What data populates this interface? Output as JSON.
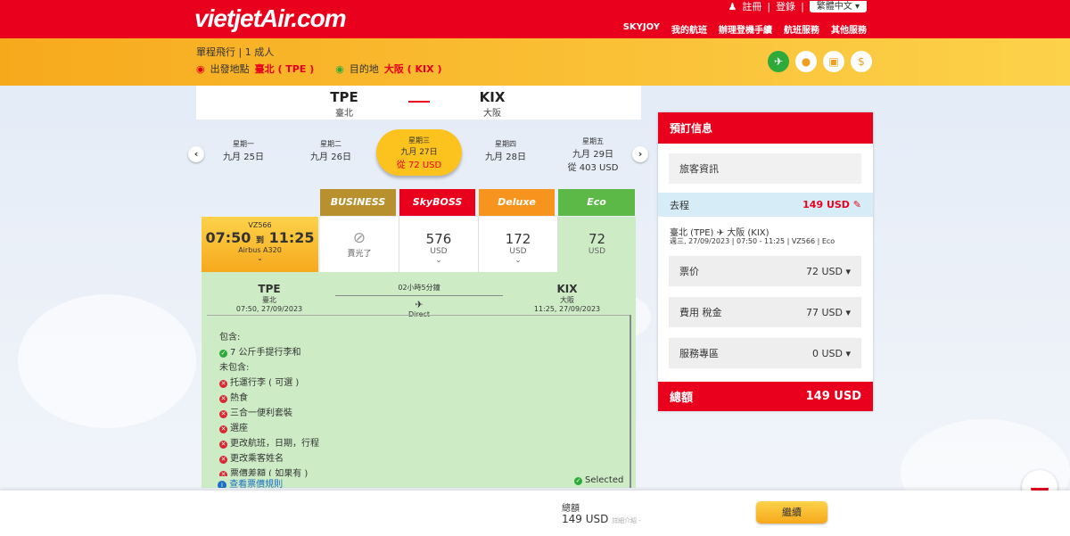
{
  "header": {
    "logo": "vietjetAir.com",
    "register": "註冊",
    "login": "登錄",
    "language": "繁體中文",
    "nav": [
      "SKYJOY",
      "我的航班",
      "辦理登機手續",
      "航班服務",
      "其他服務"
    ]
  },
  "trip": {
    "summary": "單程飛行 | 1 成人",
    "origin_label": "出發地點",
    "origin": "臺北 ( TPE )",
    "dest_label": "目的地",
    "dest": "大阪 ( KIX )"
  },
  "route": {
    "from_code": "TPE",
    "from_city": "臺北",
    "to_code": "KIX",
    "to_city": "大阪"
  },
  "dates": [
    {
      "weekday": "星期一",
      "date": "九月 25日",
      "price": ""
    },
    {
      "weekday": "星期二",
      "date": "九月 26日",
      "price": ""
    },
    {
      "weekday": "星期三",
      "date": "九月 27日",
      "price": "從 72 USD"
    },
    {
      "weekday": "星期四",
      "date": "九月 28日",
      "price": ""
    },
    {
      "weekday": "星期五",
      "date": "九月 29日",
      "price": "從 403 USD"
    }
  ],
  "fares": {
    "classes": [
      "BUSINESS",
      "SkyBOSS",
      "Deluxe",
      "Eco"
    ],
    "flight_no": "VZ566",
    "depart": "07:50",
    "to": "到",
    "arrive": "11:25",
    "aircraft": "Airbus A320",
    "business": "賣光了",
    "skyboss": "576",
    "deluxe": "172",
    "eco": "72",
    "usd": "USD"
  },
  "details": {
    "from_code": "TPE",
    "from_city": "臺北",
    "from_time": "07:50, 27/09/2023",
    "duration": "02小時5分鐘",
    "direct": "Direct",
    "to_code": "KIX",
    "to_city": "大阪",
    "to_time": "11:25, 27/09/2023",
    "included_title": "包含:",
    "included": [
      "7 公斤手提行李和"
    ],
    "excluded_title": "未包含:",
    "excluded": [
      "托運行李 ( 可選 )",
      "熱食",
      "三合一便利套裝",
      "選座",
      "更改航班，日期，行程",
      "更改乘客姓名",
      "票價差額 ( 如果有 )"
    ],
    "rules_link": "查看票價規則",
    "selected": "Selected"
  },
  "panel": {
    "title": "預訂信息",
    "pax": "旅客資訊",
    "trip_label": "去程",
    "trip_price": "149 USD",
    "route": "臺北 (TPE)",
    "route_to": "大阪 (KIX)",
    "route_info": "週三, 27/09/2023 | 07:50 - 11:25 | VZ566 | Eco",
    "fare_label": "票价",
    "fare": "72 USD",
    "tax_label": "費用 稅金",
    "tax": "77 USD",
    "service_label": "服務專區",
    "service": "0 USD",
    "total_label": "總額",
    "total": "149 USD"
  },
  "bottom": {
    "total_label": "總額",
    "total": "149 USD",
    "detail": "詳細介紹 -",
    "continue": "繼續"
  }
}
